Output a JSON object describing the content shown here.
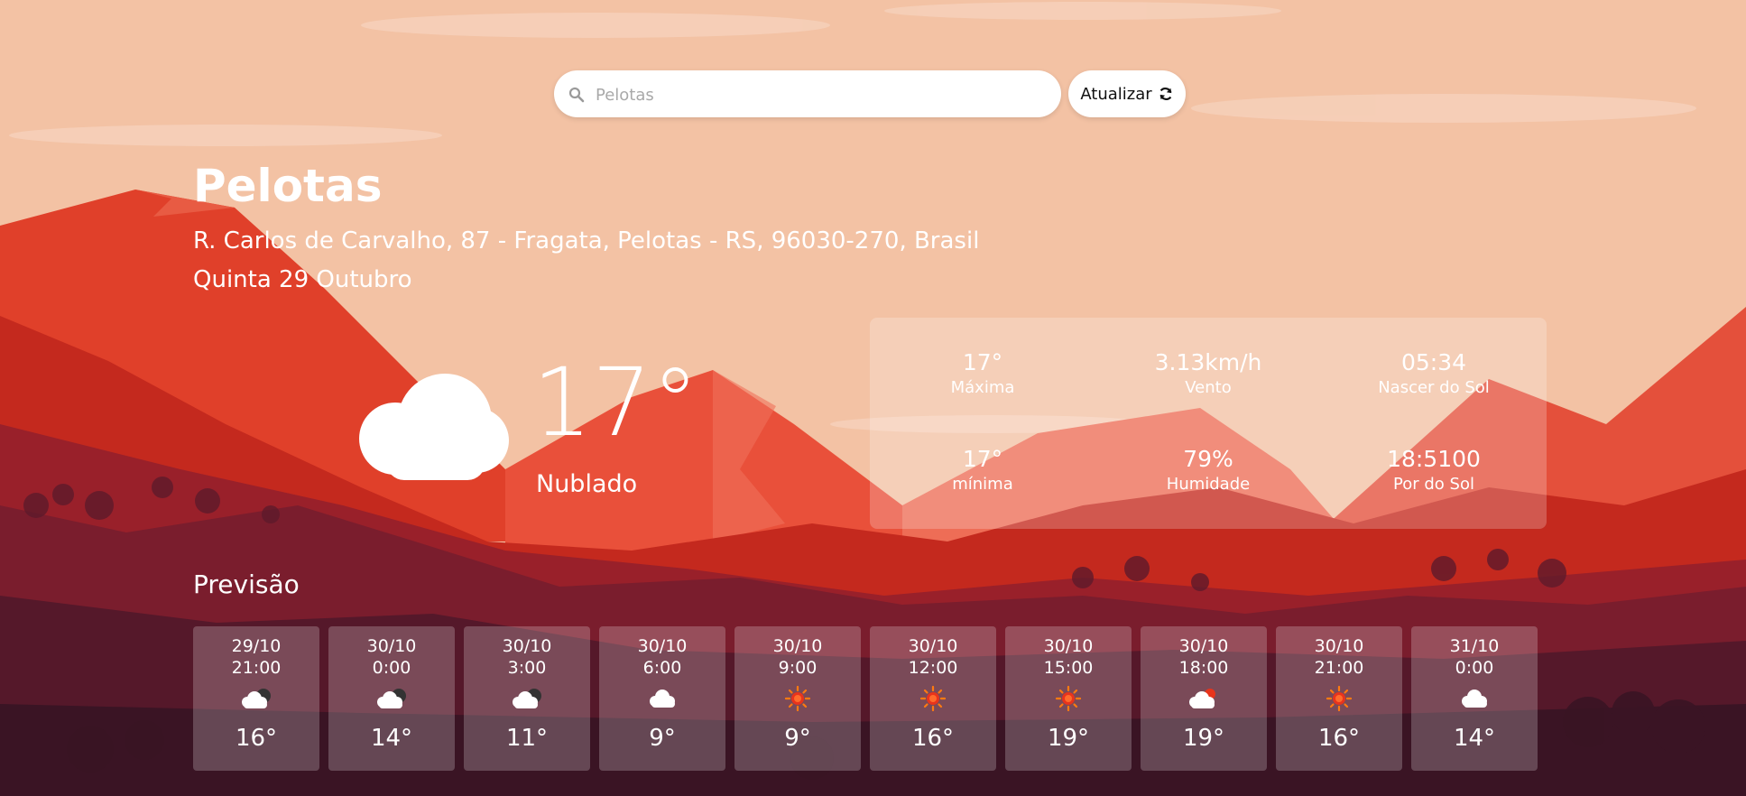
{
  "search": {
    "placeholder": "Pelotas",
    "value": "",
    "icon": "search-icon"
  },
  "refresh": {
    "label": "Atualizar",
    "icon": "refresh-icon"
  },
  "location": {
    "city": "Pelotas",
    "address": "R. Carlos de Carvalho, 87 - Fragata, Pelotas - RS, 96030-270, Brasil",
    "date": "Quinta 29 Outubro"
  },
  "current": {
    "temperature": "17°",
    "condition": "Nublado",
    "icon": "cloud-icon"
  },
  "stats": {
    "max_value": "17°",
    "max_label": "Máxima",
    "wind_value": "3.13km/h",
    "wind_label": "Vento",
    "sunrise_value": "05:34",
    "sunrise_label": "Nascer do Sol",
    "min_value": "17°",
    "min_label": "mínima",
    "humidity_value": "79%",
    "humidity_label": "Humidade",
    "sunset_value": "18:5100",
    "sunset_label": "Por do Sol"
  },
  "forecast": {
    "title": "Previsão",
    "items": [
      {
        "date": "29/10",
        "time": "21:00",
        "icon": "cloud-moon-icon",
        "temp": "16°"
      },
      {
        "date": "30/10",
        "time": "0:00",
        "icon": "cloud-moon-icon",
        "temp": "14°"
      },
      {
        "date": "30/10",
        "time": "3:00",
        "icon": "cloud-moon-icon",
        "temp": "11°"
      },
      {
        "date": "30/10",
        "time": "6:00",
        "icon": "cloud-icon",
        "temp": "9°"
      },
      {
        "date": "30/10",
        "time": "9:00",
        "icon": "sun-icon",
        "temp": "9°"
      },
      {
        "date": "30/10",
        "time": "12:00",
        "icon": "sun-icon",
        "temp": "16°"
      },
      {
        "date": "30/10",
        "time": "15:00",
        "icon": "sun-icon",
        "temp": "19°"
      },
      {
        "date": "30/10",
        "time": "18:00",
        "icon": "cloud-sun-icon",
        "temp": "19°"
      },
      {
        "date": "30/10",
        "time": "21:00",
        "icon": "sun-icon",
        "temp": "16°"
      },
      {
        "date": "31/10",
        "time": "0:00",
        "icon": "cloud-icon",
        "temp": "14°"
      }
    ]
  },
  "colors": {
    "sky": "#f3c2a4",
    "mountain_far": "#e9503a",
    "mountain_near": "#c4291e",
    "hills_dark": "#7a1d2d",
    "ground_dark": "#3a1424",
    "sun_icon": "#e8341c"
  }
}
